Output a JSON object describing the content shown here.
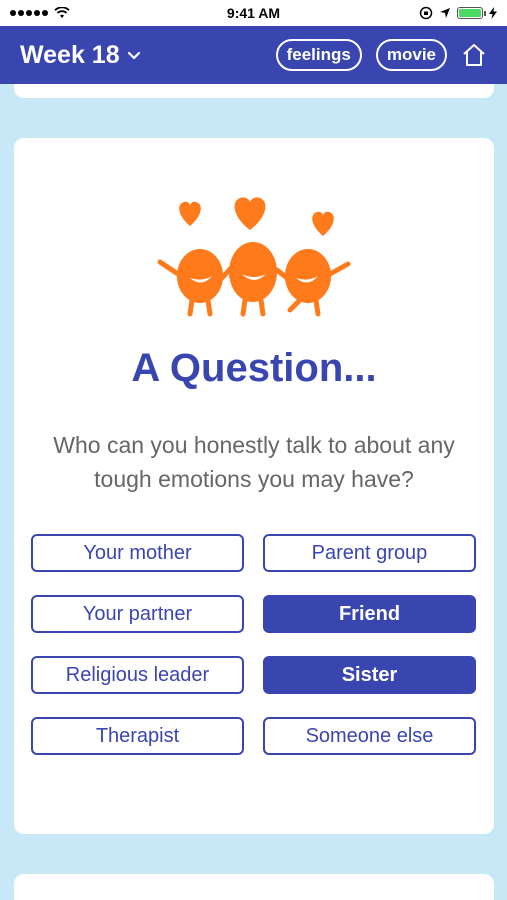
{
  "status_bar": {
    "time": "9:41 AM",
    "signal_icon": "signal-dots-icon",
    "wifi_icon": "wifi-icon",
    "battery_color": "#4cd964"
  },
  "header": {
    "title": "Week 18",
    "feelings_label": "feelings",
    "movie_label": "movie",
    "home_icon": "home-icon",
    "background_color": "#3a46b0"
  },
  "card": {
    "illustration": "three-orange-characters-with-hearts",
    "heading": "A Question...",
    "question": "Who can you honestly talk to about any tough emotions you may have?",
    "accent_color": "#3a46b0",
    "mascot_color": "#ff7a1a",
    "options": [
      {
        "label": "Your mother",
        "selected": false
      },
      {
        "label": "Parent group",
        "selected": false
      },
      {
        "label": "Your partner",
        "selected": false
      },
      {
        "label": "Friend",
        "selected": true
      },
      {
        "label": "Religious leader",
        "selected": false
      },
      {
        "label": "Sister",
        "selected": true
      },
      {
        "label": "Therapist",
        "selected": false
      },
      {
        "label": "Someone else",
        "selected": false
      }
    ]
  }
}
